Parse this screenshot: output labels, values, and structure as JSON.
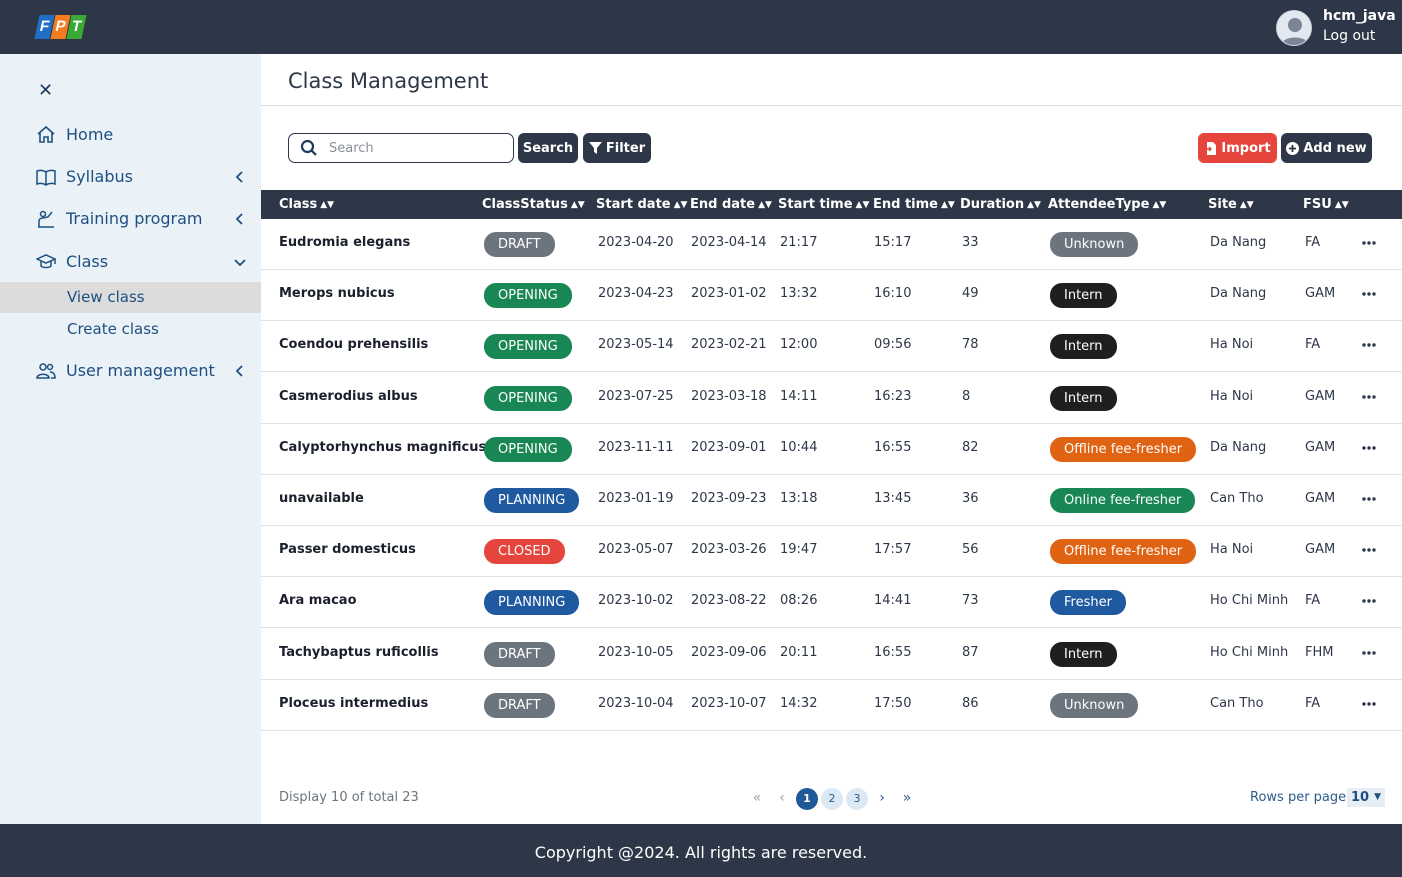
{
  "header": {
    "logo_letters": [
      "F",
      "P",
      "T"
    ],
    "user_name": "hcm_java",
    "logout_label": "Log out"
  },
  "sidebar": {
    "close_icon": "close-icon",
    "items": [
      {
        "label": "Home",
        "icon": "home-icon"
      },
      {
        "label": "Syllabus",
        "icon": "book-icon"
      },
      {
        "label": "Training program",
        "icon": "presenter-icon"
      },
      {
        "label": "Class",
        "icon": "graduation-cap-icon"
      },
      {
        "label": "User management",
        "icon": "users-icon"
      }
    ],
    "class_subitems": [
      {
        "label": "View class",
        "active": true
      },
      {
        "label": "Create class",
        "active": false
      }
    ]
  },
  "page": {
    "title": "Class Management"
  },
  "toolbar": {
    "search_placeholder": "Search",
    "search_value": "",
    "search_button": "Search",
    "filter_button": "Filter",
    "import_button": "Import",
    "add_button": "Add new"
  },
  "table": {
    "columns": [
      "Class",
      "ClassStatus",
      "Start date",
      "End date",
      "Start time",
      "End time",
      "Duration",
      "AttendeeType",
      "Site",
      "FSU"
    ],
    "rows": [
      {
        "class": "Eudromia elegans",
        "status": "DRAFT",
        "start_date": "2023-04-20",
        "end_date": "2023-04-14",
        "start_time": "21:17",
        "end_time": "15:17",
        "duration": "33",
        "attendee": "Unknown",
        "site": "Da Nang",
        "fsu": "FA"
      },
      {
        "class": "Merops nubicus",
        "status": "OPENING",
        "start_date": "2023-04-23",
        "end_date": "2023-01-02",
        "start_time": "13:32",
        "end_time": "16:10",
        "duration": "49",
        "attendee": "Intern",
        "site": "Da Nang",
        "fsu": "GAM"
      },
      {
        "class": "Coendou prehensilis",
        "status": "OPENING",
        "start_date": "2023-05-14",
        "end_date": "2023-02-21",
        "start_time": "12:00",
        "end_time": "09:56",
        "duration": "78",
        "attendee": "Intern",
        "site": "Ha Noi",
        "fsu": "FA"
      },
      {
        "class": "Casmerodius albus",
        "status": "OPENING",
        "start_date": "2023-07-25",
        "end_date": "2023-03-18",
        "start_time": "14:11",
        "end_time": "16:23",
        "duration": "8",
        "attendee": "Intern",
        "site": "Ha Noi",
        "fsu": "GAM"
      },
      {
        "class": "Calyptorhynchus magnificus",
        "status": "OPENING",
        "start_date": "2023-11-11",
        "end_date": "2023-09-01",
        "start_time": "10:44",
        "end_time": "16:55",
        "duration": "82",
        "attendee": "Offline fee-fresher",
        "site": "Da Nang",
        "fsu": "GAM"
      },
      {
        "class": "unavailable",
        "status": "PLANNING",
        "start_date": "2023-01-19",
        "end_date": "2023-09-23",
        "start_time": "13:18",
        "end_time": "13:45",
        "duration": "36",
        "attendee": "Online fee-fresher",
        "site": "Can Tho",
        "fsu": "GAM"
      },
      {
        "class": "Passer domesticus",
        "status": "CLOSED",
        "start_date": "2023-05-07",
        "end_date": "2023-03-26",
        "start_time": "19:47",
        "end_time": "17:57",
        "duration": "56",
        "attendee": "Offline fee-fresher",
        "site": "Ha Noi",
        "fsu": "GAM"
      },
      {
        "class": "Ara macao",
        "status": "PLANNING",
        "start_date": "2023-10-02",
        "end_date": "2023-08-22",
        "start_time": "08:26",
        "end_time": "14:41",
        "duration": "73",
        "attendee": "Fresher",
        "site": "Ho Chi Minh",
        "fsu": "FA"
      },
      {
        "class": "Tachybaptus ruficollis",
        "status": "DRAFT",
        "start_date": "2023-10-05",
        "end_date": "2023-09-06",
        "start_time": "20:11",
        "end_time": "16:55",
        "duration": "87",
        "attendee": "Intern",
        "site": "Ho Chi Minh",
        "fsu": "FHM"
      },
      {
        "class": "Ploceus intermedius",
        "status": "DRAFT",
        "start_date": "2023-10-04",
        "end_date": "2023-10-07",
        "start_time": "14:32",
        "end_time": "17:50",
        "duration": "86",
        "attendee": "Unknown",
        "site": "Can Tho",
        "fsu": "FA"
      }
    ]
  },
  "colors": {
    "status": {
      "DRAFT": "#6c757d",
      "OPENING": "#198754",
      "PLANNING": "#1f5aa0",
      "CLOSED": "#e5453c"
    },
    "attendee": {
      "Unknown": "#6c757d",
      "Intern": "#1f1f1f",
      "Offline fee-fresher": "#e06314",
      "Online fee-fresher": "#198754",
      "Fresher": "#1f5aa0"
    }
  },
  "pagination": {
    "display_text": "Display 10 of total 23",
    "pages": [
      "1",
      "2",
      "3"
    ],
    "current_page": "1",
    "rows_per_page_label": "Rows per page",
    "rows_per_page_value": "10"
  },
  "footer": {
    "text": "Copyright @2024. All rights are reserved."
  }
}
